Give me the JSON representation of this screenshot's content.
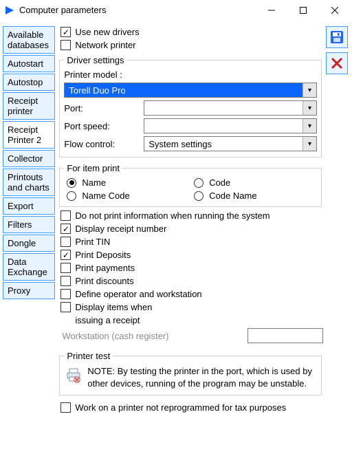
{
  "window": {
    "title": "Computer parameters"
  },
  "sidebar": {
    "items": [
      {
        "label": "Available databases"
      },
      {
        "label": "Autostart"
      },
      {
        "label": "Autostop"
      },
      {
        "label": "Receipt printer"
      },
      {
        "label": "Receipt Printer 2",
        "selected": true
      },
      {
        "label": "Collector"
      },
      {
        "label": "Printouts and charts"
      },
      {
        "label": "Export"
      },
      {
        "label": "Filters"
      },
      {
        "label": "Dongle"
      },
      {
        "label": "Data Exchange"
      },
      {
        "label": "Proxy"
      }
    ]
  },
  "toolbar": {
    "save_title": "Save",
    "cancel_title": "Cancel"
  },
  "top_checks": {
    "use_new_drivers": {
      "label": "Use new drivers",
      "checked": true
    },
    "network_printer": {
      "label": "Network printer",
      "checked": false
    }
  },
  "driver_settings": {
    "legend": "Driver settings",
    "printer_model_label": "Printer model :",
    "printer_model_value": "Torell Duo Pro",
    "port_label": "Port:",
    "port_value": "",
    "port_speed_label": "Port speed:",
    "port_speed_value": "",
    "flow_control_label": "Flow control:",
    "flow_control_value": "System settings"
  },
  "item_print": {
    "legend": "For item print",
    "name": "Name",
    "code": "Code",
    "name_code": "Name Code",
    "code_name": "Code Name",
    "selected": "name"
  },
  "mid_checks": {
    "no_print_info": {
      "label": "Do not print information when running the system",
      "checked": false
    },
    "display_receipt_no": {
      "label": "Display receipt number",
      "checked": true
    },
    "print_tin": {
      "label": "Print TIN",
      "checked": false
    },
    "print_deposits": {
      "label": "Print Deposits",
      "checked": true
    },
    "print_payments": {
      "label": "Print payments",
      "checked": false
    },
    "print_discounts": {
      "label": "Print discounts",
      "checked": false
    },
    "define_op_ws": {
      "label": "Define operator and workstation",
      "checked": false
    },
    "display_items": {
      "label": "Display items when",
      "line2": "issuing a receipt",
      "checked": false
    }
  },
  "workstation": {
    "label": "Workstation (cash register)",
    "value": ""
  },
  "printer_test": {
    "legend": "Printer test",
    "note": "NOTE: By testing the printer in the port, which is used by other devices, running of the program may be unstable."
  },
  "bottom_check": {
    "label": "Work on a printer not reprogrammed for tax purposes",
    "checked": false
  }
}
